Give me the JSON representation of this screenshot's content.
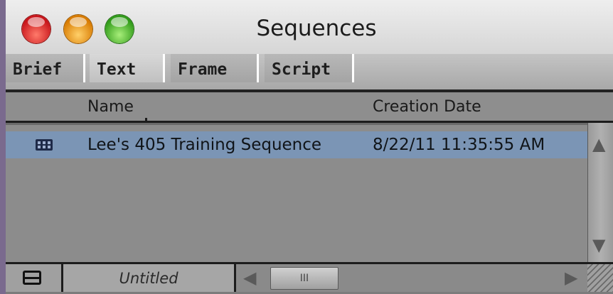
{
  "window": {
    "title": "Sequences",
    "controls": [
      "close-button",
      "minimize-button",
      "zoom-button"
    ]
  },
  "tabs": [
    {
      "label": "Brief",
      "active": false
    },
    {
      "label": "Text",
      "active": true
    },
    {
      "label": "Frame",
      "active": false
    },
    {
      "label": "Script",
      "active": false
    }
  ],
  "columns": {
    "name": "Name",
    "creation_date": "Creation Date"
  },
  "rows": [
    {
      "icon": "sequence-icon",
      "name": "Lee's 405 Training Sequence",
      "creation_date": "8/22/11 11:35:55 AM",
      "selected": true
    }
  ],
  "statusbar": {
    "bin_name": "Untitled",
    "scroll_thumb_label": "III"
  },
  "colors": {
    "selection": "#7b95b5",
    "background": "#8c8c8c"
  }
}
